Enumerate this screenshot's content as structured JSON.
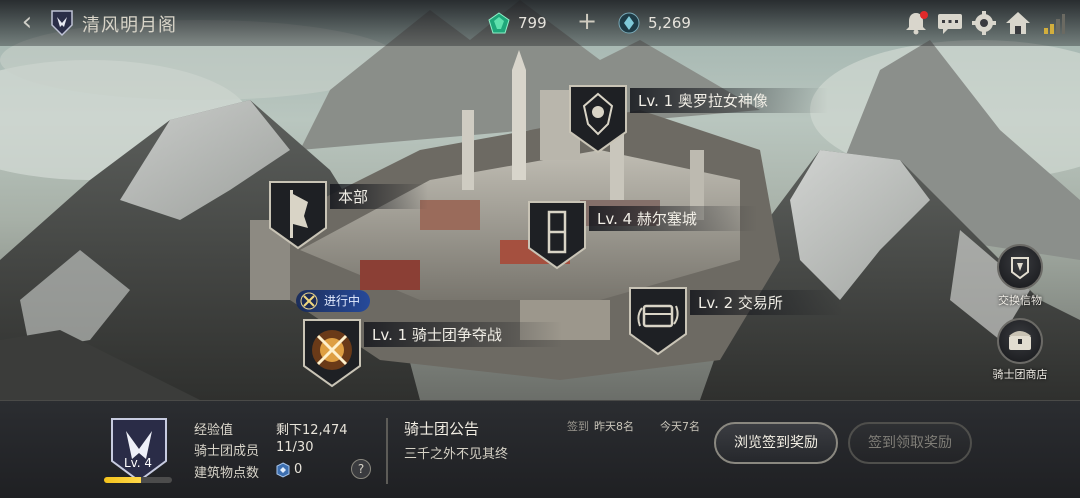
{
  "header": {
    "back_icon": "back-arrow-icon",
    "guild_name": "清风明月阁",
    "currency_gem": {
      "icon": "green-gem-icon",
      "value": "799"
    },
    "plus_icon": "plus-icon",
    "currency_crystal": {
      "icon": "blue-crystal-icon",
      "value": "5,269"
    },
    "icons": [
      "bell-icon",
      "chat-icon",
      "gear-icon",
      "home-icon",
      "signal-icon"
    ],
    "notification_dot_color": "#e02a2a"
  },
  "buildings": [
    {
      "label": "Lv. 1  奥罗拉女神像",
      "icon": "goddess-statue-icon"
    },
    {
      "label": "本部",
      "icon": "headquarters-banner-icon"
    },
    {
      "label": "Lv. 4  赫尔塞城",
      "icon": "castle-tower-icon"
    },
    {
      "label": "Lv. 2  交易所",
      "icon": "exchange-chest-icon"
    },
    {
      "label": "Lv. 1  骑士团争夺战",
      "icon": "crossed-swords-icon",
      "status": "进行中"
    }
  ],
  "side_buttons": [
    {
      "label": "交换信物",
      "icon": "token-exchange-icon"
    },
    {
      "label": "骑士团商店",
      "icon": "guild-shop-chest-icon"
    }
  ],
  "guild_info": {
    "level_label": "Lv. 4",
    "xp_progress": 0.55,
    "rows": [
      {
        "label": "经验值",
        "value": "剩下12,474"
      },
      {
        "label": "骑士团成员",
        "value": "11/30"
      },
      {
        "label": "建筑物点数",
        "value": "0"
      }
    ],
    "help_label": "?"
  },
  "notice": {
    "title": "骑士团公告",
    "text": "三千之外不见其终"
  },
  "signin": {
    "label": "签到",
    "yesterday": "昨天8名",
    "today": "今天7名",
    "browse_button": "浏览签到奖励",
    "claim_button": "签到领取奖励"
  },
  "colors": {
    "accent_gold": "#f3c21c",
    "ongoing_blue": "#2a4fa0",
    "panel_bg": "#2b2d31"
  }
}
